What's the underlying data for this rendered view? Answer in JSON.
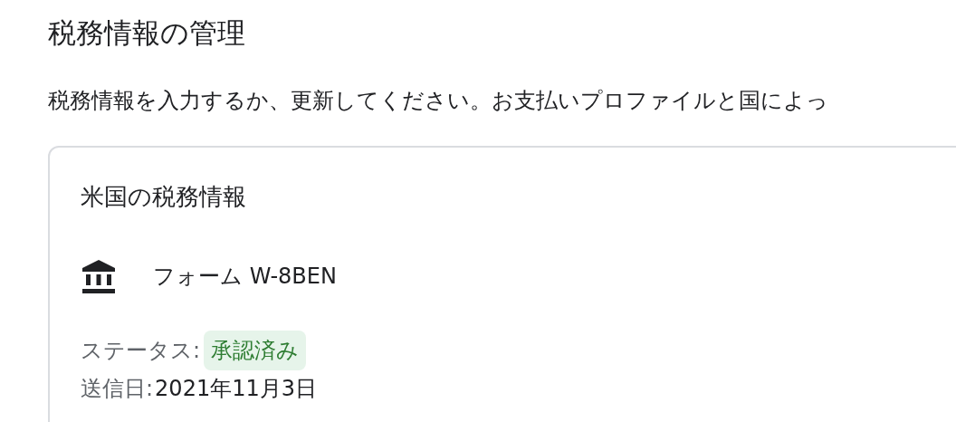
{
  "title": "税務情報の管理",
  "description": "税務情報を入力するか、更新してください。お支払いプロファイルと国によっ",
  "card": {
    "title": "米国の税務情報",
    "form": {
      "label": "フォーム W-8BEN"
    },
    "fields": [
      {
        "label": "ステータス:",
        "value": "承認済み",
        "kind": "badge"
      },
      {
        "label": "送信日:",
        "value": "2021年11月3日",
        "kind": "text"
      }
    ]
  }
}
